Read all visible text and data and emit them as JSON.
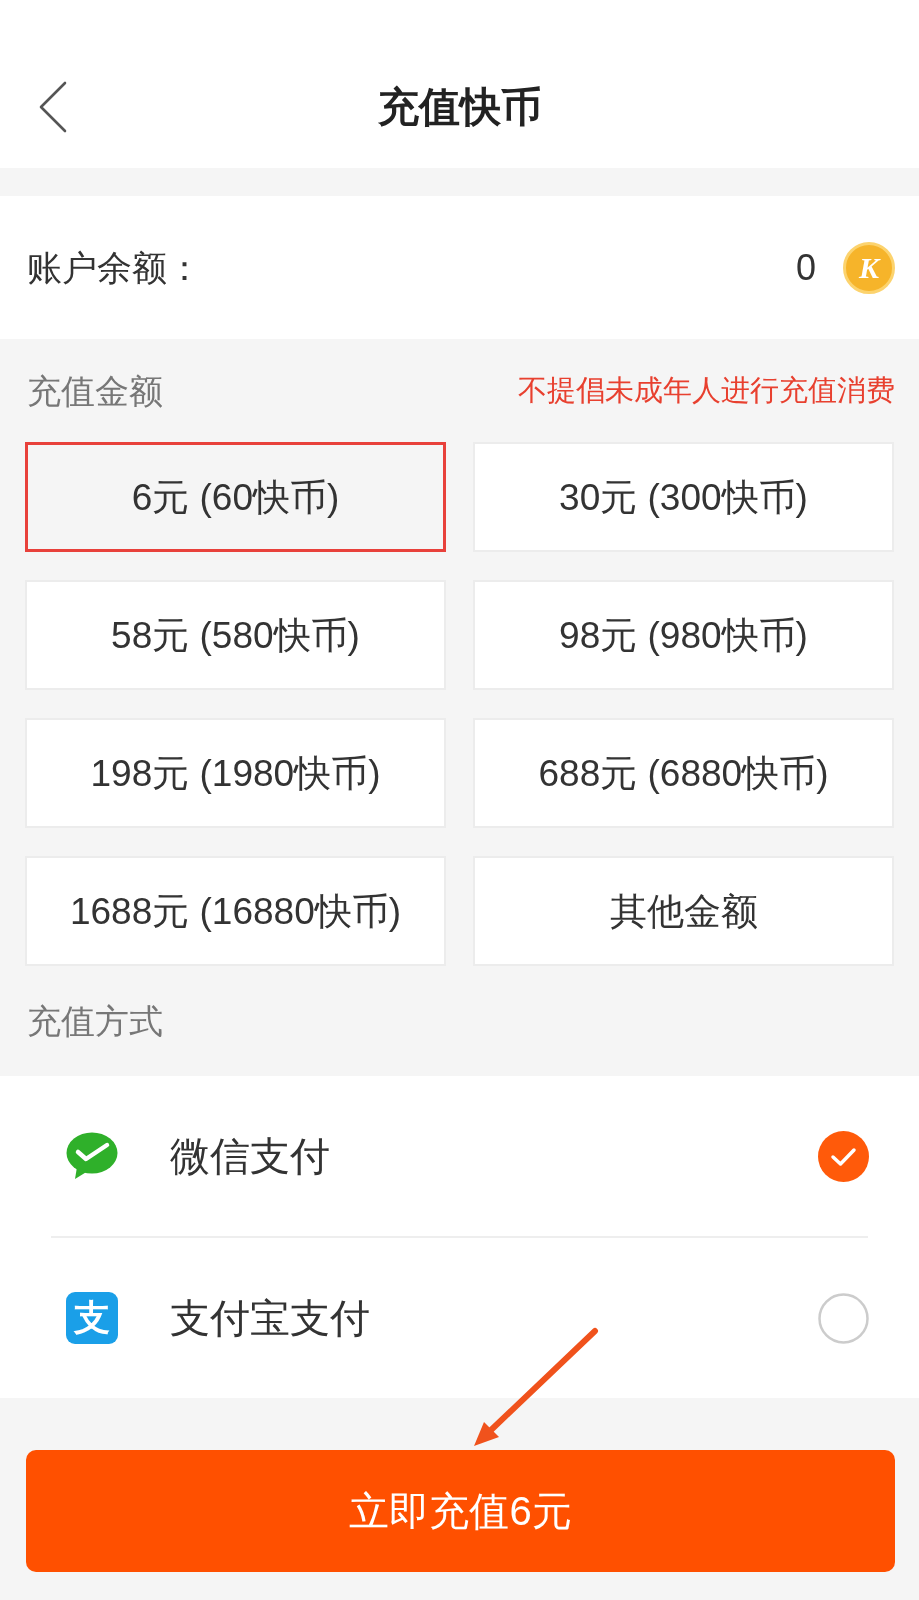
{
  "header": {
    "title": "充值快币"
  },
  "balance": {
    "label": "账户余额：",
    "value": "0",
    "coin_symbol": "K"
  },
  "amount_section": {
    "title": "充值金额",
    "notice": "不提倡未成年人进行充值消费"
  },
  "amounts": [
    {
      "label": "6元 (60快币)",
      "selected": true
    },
    {
      "label": "30元 (300快币)",
      "selected": false
    },
    {
      "label": "58元 (580快币)",
      "selected": false
    },
    {
      "label": "98元 (980快币)",
      "selected": false
    },
    {
      "label": "198元 (1980快币)",
      "selected": false
    },
    {
      "label": "688元 (6880快币)",
      "selected": false
    },
    {
      "label": "1688元 (16880快币)",
      "selected": false
    },
    {
      "label": "其他金额",
      "selected": false
    }
  ],
  "method_section": {
    "title": "充值方式"
  },
  "methods": [
    {
      "kind": "wechat",
      "label": "微信支付",
      "selected": true
    },
    {
      "kind": "alipay",
      "label": "支付宝支付",
      "icon_text": "支",
      "selected": false
    }
  ],
  "submit": {
    "label": "立即充值6元"
  }
}
